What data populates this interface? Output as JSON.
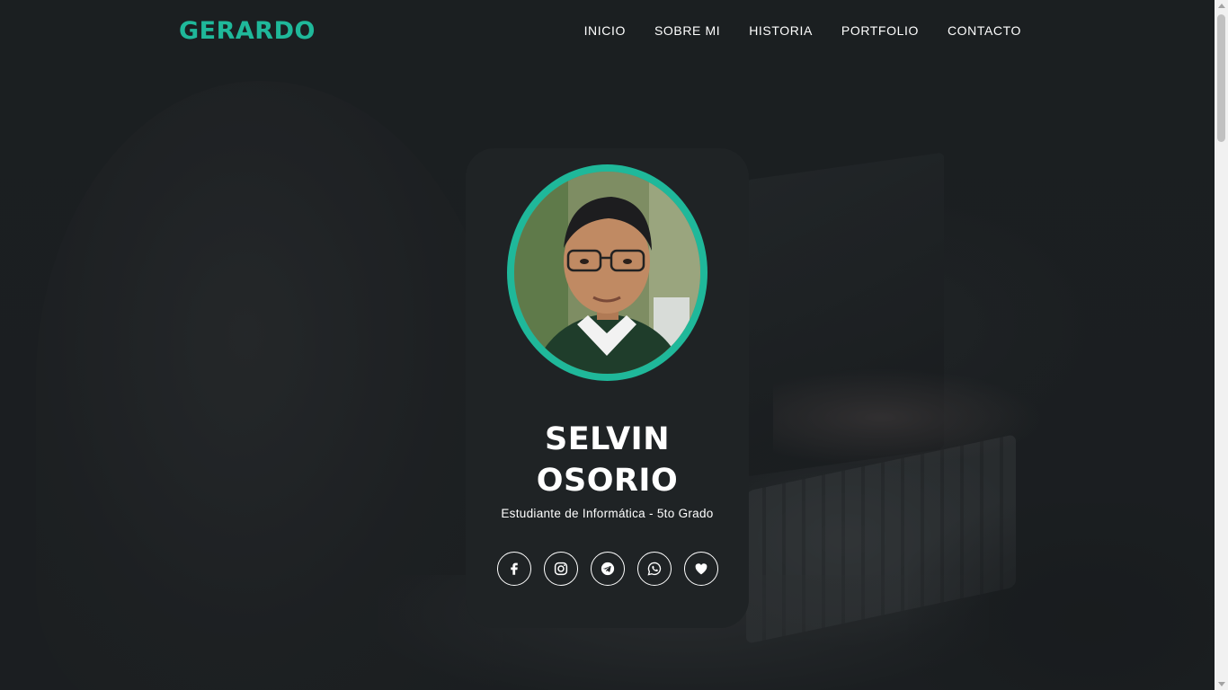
{
  "brand": {
    "logo": "GERARDO"
  },
  "nav": {
    "items": [
      {
        "label": "INICIO"
      },
      {
        "label": "SOBRE MI"
      },
      {
        "label": "HISTORIA"
      },
      {
        "label": "PORTFOLIO"
      },
      {
        "label": "CONTACTO"
      }
    ]
  },
  "profile": {
    "first_name": "SELVIN",
    "last_name": "OSORIO",
    "subtitle": "Estudiante de Informática - 5to Grado",
    "socials": [
      {
        "icon": "facebook-icon"
      },
      {
        "icon": "instagram-icon"
      },
      {
        "icon": "telegram-icon"
      },
      {
        "icon": "whatsapp-icon"
      },
      {
        "icon": "heart-icon"
      }
    ]
  },
  "colors": {
    "accent": "#1fb89a",
    "background": "#1b1f21",
    "card": "#1f2325",
    "text": "#ffffff"
  }
}
